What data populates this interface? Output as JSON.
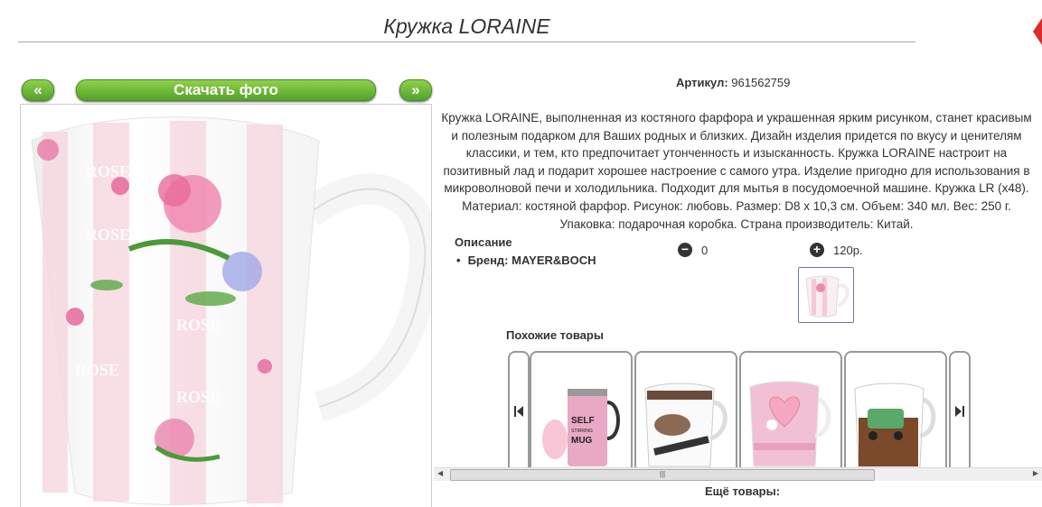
{
  "header": {
    "title": "Кружка LORAINE"
  },
  "gallery": {
    "prev_label": "«",
    "download_label": "Скачать фото",
    "next_label": "»"
  },
  "product": {
    "artikul_label": "Артикул:",
    "artikul_value": "961562759",
    "description": "Кружка LORAINE, выполненная из костяного фарфора и украшенная ярким рисунком, станет красивым и полезным подарком для Ваших родных и близких. Дизайн изделия придется по вкусу и ценителям классики, и тем, кто предпочитает утонченность и изысканность. Кружка LORAINE настроит на позитивный лад и подарит хорошее настроение с самого утра. Изделие пригодно для использования в микроволновой печи и холодильника. Подходит для мытья в посудомоечной машине. Кружка LR (x48). Материал: костяной фарфор. Рисунок: любовь. Размер: D8 х 10,3 см. Объем: 340 мл. Вес: 250 г. Упаковка: подарочная коробка. Страна производитель: Китай.",
    "section_label": "Описание",
    "brand_line": "Бренд: MAYER&BOCH",
    "qty_minus": "−",
    "qty_value": "0",
    "qty_plus": "+",
    "price": "120р."
  },
  "mug_print": "ROSE",
  "similar": {
    "title": "Похожие товары",
    "prev_icon": "skip-back-icon",
    "next_icon": "skip-forward-icon",
    "cards": [
      {
        "name": "self-stirring-mug",
        "text1": "SELF",
        "text2": "STIRRING",
        "text3": "MUG",
        "color": "#e8b0c8"
      },
      {
        "name": "coffee-mug",
        "text1": "",
        "color": "#fff"
      },
      {
        "name": "heart-mug",
        "text1": "",
        "color": "#f2c0d4"
      },
      {
        "name": "cafe-mug",
        "text1": "",
        "color": "#fff"
      }
    ]
  },
  "more": {
    "title": "Ещё товары:"
  },
  "colors": {
    "accent": "#52a32a",
    "close": "#d92c2c"
  }
}
